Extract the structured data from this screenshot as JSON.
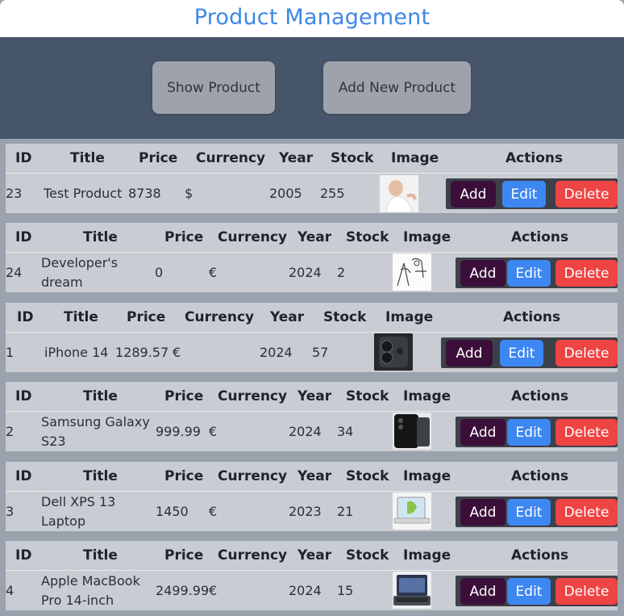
{
  "app": {
    "title": "Product Management"
  },
  "header": {
    "show_label": "Show Product",
    "add_label": "Add New Product"
  },
  "table_headers": [
    "ID",
    "Title",
    "Price",
    "Currency",
    "Year",
    "Stock",
    "Image",
    "Actions"
  ],
  "action_labels": {
    "add": "Add",
    "edit": "Edit",
    "delete": "Delete"
  },
  "products": [
    {
      "id": "23",
      "title": "Test Product",
      "price": "8738",
      "currency": "$",
      "year": "2005",
      "stock": "255",
      "image": "person-photo"
    },
    {
      "id": "24",
      "title": "Developer's dream",
      "price": "0",
      "currency": "€",
      "year": "2024",
      "stock": "2",
      "image": "sketch-drawing"
    },
    {
      "id": "1",
      "title": "iPhone 14",
      "price": "1289.57",
      "currency": "€",
      "year": "2024",
      "stock": "57",
      "image": "iphone-image"
    },
    {
      "id": "2",
      "title": "Samsung Galaxy S23",
      "price": "999.99",
      "currency": "€",
      "year": "2024",
      "stock": "34",
      "image": "samsung-phone-image"
    },
    {
      "id": "3",
      "title": "Dell XPS 13 Laptop",
      "price": "1450",
      "currency": "€",
      "year": "2023",
      "stock": "21",
      "image": "laptop-image"
    },
    {
      "id": "4",
      "title": "Apple MacBook Pro 14-inch",
      "price": "2499.99",
      "currency": "€",
      "year": "2024",
      "stock": "15",
      "image": "macbook-image"
    }
  ]
}
